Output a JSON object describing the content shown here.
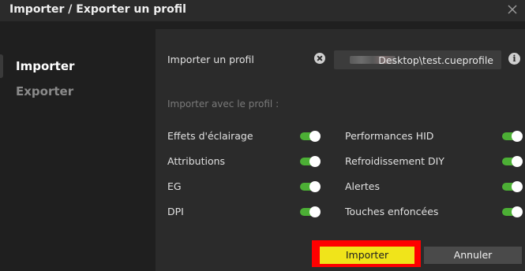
{
  "window": {
    "title": "Importer / Exporter un profil"
  },
  "sidebar": {
    "items": [
      {
        "label": "Importer",
        "active": true
      },
      {
        "label": "Exporter",
        "active": false
      }
    ]
  },
  "import_profile": {
    "label": "Importer un profil",
    "path_value": "Desktop\\test.cueprofile"
  },
  "section": {
    "label": "Importer avec le profil :"
  },
  "options_left": [
    {
      "label": "Effets d'éclairage",
      "enabled": true
    },
    {
      "label": "Attributions",
      "enabled": true
    },
    {
      "label": "EG",
      "enabled": true
    },
    {
      "label": "DPI",
      "enabled": true
    }
  ],
  "options_right": [
    {
      "label": "Performances HID",
      "enabled": true
    },
    {
      "label": "Refroidissement DIY",
      "enabled": true
    },
    {
      "label": "Alertes",
      "enabled": true
    },
    {
      "label": "Touches enfoncées",
      "enabled": true
    }
  ],
  "buttons": {
    "import_label": "Importer",
    "cancel_label": "Annuler"
  },
  "colors": {
    "accent": "#f0e41a",
    "toggle_on": "#4caf35",
    "highlight": "#ff0000"
  }
}
